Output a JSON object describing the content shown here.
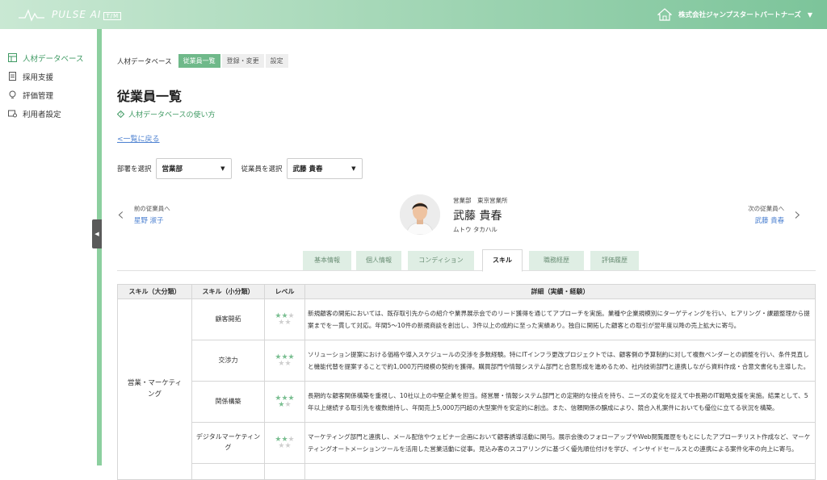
{
  "header": {
    "brand": "PULSE AI",
    "brand_tm": "T/M",
    "company": "株式会社ジャンプスタートパートナーズ",
    "colors": {
      "brand_green": "#7cc49a",
      "accent": "#3f9a63",
      "link": "#4a7fd0"
    }
  },
  "sidebar": {
    "items": [
      {
        "label": "人材データベース",
        "icon": "database-icon"
      },
      {
        "label": "採用支援",
        "icon": "document-icon"
      },
      {
        "label": "評価管理",
        "icon": "lightbulb-icon"
      },
      {
        "label": "利用者設定",
        "icon": "user-settings-icon"
      }
    ],
    "toggle": "◀"
  },
  "breadcrumb": {
    "label": "人材データベース",
    "tabs": [
      "従業員一覧",
      "登録・変更",
      "設定"
    ]
  },
  "page": {
    "title": "従業員一覧",
    "howto": "人材データベースの使い方",
    "back_link": "<一覧に戻る"
  },
  "filters": {
    "dept_label": "部署を選択",
    "dept_value": "営業部",
    "emp_label": "従業員を選択",
    "emp_value": "武藤 貴春"
  },
  "employee_nav": {
    "prev_label": "前の従業員へ",
    "prev_name": "星野 淑子",
    "next_label": "次の従業員へ",
    "next_name": "武藤 貴春",
    "dept": "営業部　東京営業所",
    "name": "武藤 貴春",
    "kana": "ムトウ タカハル"
  },
  "tabs": [
    "基本情報",
    "個人情報",
    "コンディション",
    "スキル",
    "職務経歴",
    "評価履歴"
  ],
  "table": {
    "headers": [
      "スキル（大分類）",
      "スキル（小分類）",
      "レベル",
      "詳細（実績・経験）"
    ],
    "category": "営業・マーケティング",
    "rows": [
      {
        "sub": "顧客開拓",
        "level": 2,
        "detail": "新規顧客の開拓においては、既存取引先からの紹介や業界展示会でのリード獲得を通じてアプローチを実施。業種や企業規模別にターゲティングを行い、ヒアリング・課題整理から提案までを一貫して対応。年間5〜10件の新規商談を創出し、3件以上の成約に至った実績あり。独自に開拓した顧客との取引が翌年度以降の売上拡大に寄与。"
      },
      {
        "sub": "交渉力",
        "level": 3,
        "detail": "ソリューション提案における価格や導入スケジュールの交渉を多数経験。特にITインフラ更改プロジェクトでは、顧客側の予算制約に対して複数ベンダーとの調整を行い、条件見直しと機能代替を提案することで約1,000万円規模の契約を獲得。購買部門や情報システム部門と合意形成を進めるため、社内技術部門と連携しながら資料作成・合意文書化も主導した。"
      },
      {
        "sub": "関係構築",
        "level": 4,
        "detail": "長期的な顧客関係構築を重視し、10社以上の中堅企業を担当。経営層・情報システム部門との定期的な接点を持ち、ニーズの変化を捉えて中長期のIT戦略支援を実施。結果として、5年以上継続する取引先を複数維持し、年間売上5,000万円超の大型案件を安定的に創出。また、信頼関係の醸成により、競合入札案件においても優位に立てる状況を構築。"
      },
      {
        "sub": "デジタルマーケティング",
        "level": 2,
        "detail": "マーケティング部門と連携し、メール配信やウェビナー企画において顧客誘導活動に関与。展示会後のフォローアップやWeb閲覧履歴をもとにしたアプローチリスト作成など、マーケティングオートメーションツールを活用した営業活動に従事。見込み客のスコアリングに基づく優先順位付けを学び、インサイドセールスとの連携による案件化率の向上に寄与。"
      }
    ],
    "max_level": 5
  }
}
